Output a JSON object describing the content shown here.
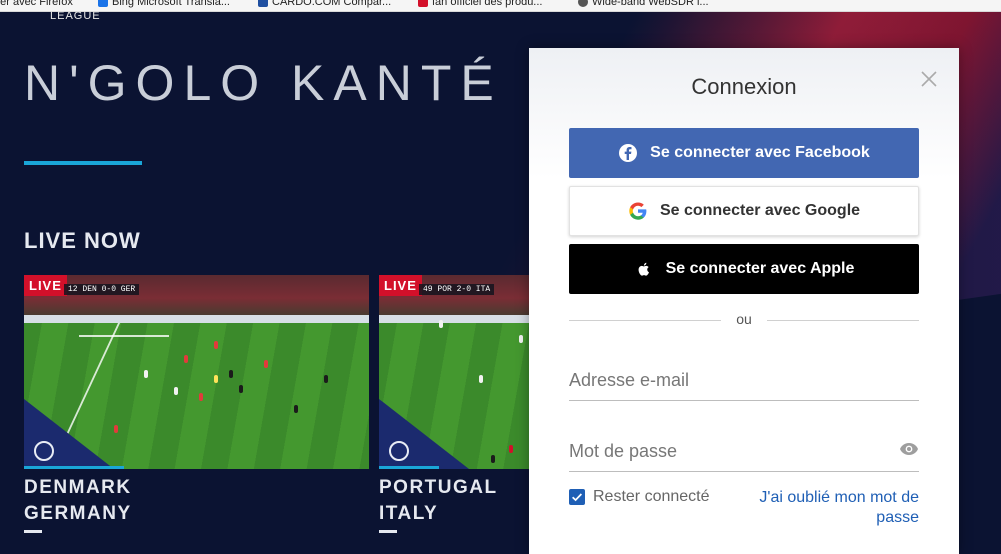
{
  "bookmarks": [
    {
      "label": "tter avec Firefox",
      "color": "#e66000"
    },
    {
      "label": "Bing Microsoft Transla...",
      "color": "#1a73e8"
    },
    {
      "label": "CARDO.COM Compar...",
      "color": "#1f4fa0"
    },
    {
      "label": "fan officiel des produ...",
      "color": "#d3102a"
    },
    {
      "label": "Wide-band WebSDR i...",
      "color": "#555555"
    }
  ],
  "hero": {
    "league": "LEAGUE",
    "player_name": "N'GOLO KANTÉ",
    "section_title": "LIVE NOW"
  },
  "matches": [
    {
      "live_label": "LIVE",
      "scorebug": "12 DEN 0-0 GER",
      "title_line1": "DENMARK",
      "title_line2": "GERMANY"
    },
    {
      "live_label": "LIVE",
      "scorebug": "49 POR 2-0 ITA",
      "title_line1": "PORTUGAL",
      "title_line2": "ITALY"
    }
  ],
  "login": {
    "title": "Connexion",
    "facebook_label": "Se connecter avec Facebook",
    "google_label": "Se connecter avec Google",
    "apple_label": "Se connecter avec Apple",
    "or_text": "ou",
    "email_placeholder": "Adresse e-mail",
    "password_placeholder": "Mot de passe",
    "remember_label": "Rester connecté",
    "forgot_label": "J'ai oublié mon mot de passe"
  },
  "colors": {
    "facebook": "#4267b2",
    "apple": "#000000",
    "accent": "#1aa6d8",
    "live_badge": "#d3102a",
    "link": "#1f5fb5"
  }
}
